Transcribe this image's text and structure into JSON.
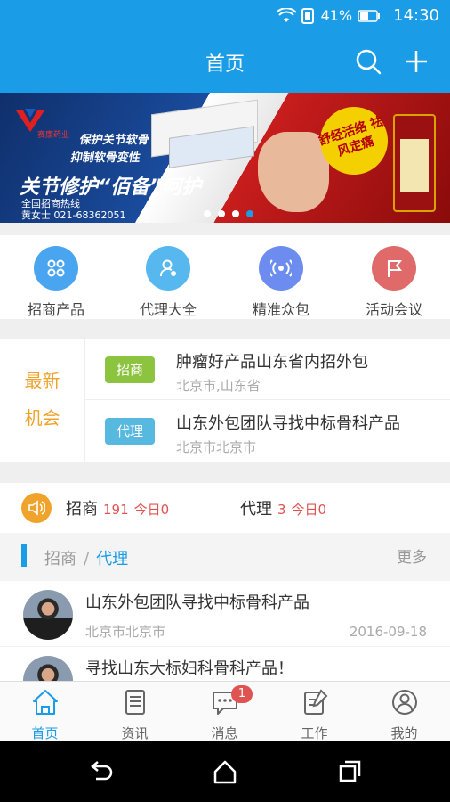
{
  "status_bar": {
    "battery": "41%",
    "time": "14:30"
  },
  "app_bar": {
    "title": "首页"
  },
  "banner": {
    "logo_text": "赛康药业",
    "tag1": "保护关节软骨",
    "tag2": "抑制软骨变性",
    "slogan": "关节修护“佰备”呵护",
    "hotline_line1": "全国招商热线",
    "hotline_line2": "黄女士  021-68362051",
    "promo": "舒经活络 祛风定痛",
    "slides": 4,
    "active_slide": 4
  },
  "quick_menu": [
    {
      "label": "招商产品",
      "icon": "grid-icon",
      "color": "#4aa5f0"
    },
    {
      "label": "代理大全",
      "icon": "user-badge-icon",
      "color": "#57b8f0"
    },
    {
      "label": "精准众包",
      "icon": "broadcast-icon",
      "color": "#6c8cf0"
    },
    {
      "label": "活动会议",
      "icon": "flag-icon",
      "color": "#e06a6a"
    }
  ],
  "latest": {
    "title_line1": "最新",
    "title_line2": "机会",
    "items": [
      {
        "badge": "招商",
        "badge_color": "#8cc43f",
        "title": "肿瘤好产品山东省内招外包",
        "location": "北京市,山东省"
      },
      {
        "badge": "代理",
        "badge_color": "#57b8e0",
        "title": "山东外包团队寻找中标骨科产品",
        "location": "北京市北京市"
      }
    ]
  },
  "stats": {
    "zhaoshang_label": "招商",
    "zhaoshang_count": "191",
    "zhaoshang_today": "今日0",
    "daili_label": "代理",
    "daili_count": "3",
    "daili_today": "今日0"
  },
  "section": {
    "tab_a": "招商",
    "separator": "/",
    "tab_b": "代理",
    "more": "更多"
  },
  "list": [
    {
      "title": "山东外包团队寻找中标骨科产品",
      "location": "北京市北京市",
      "date": "2016-09-18"
    },
    {
      "title": "寻找山东大标妇科骨科产品！",
      "location": "",
      "date": ""
    }
  ],
  "tab_bar": [
    {
      "label": "首页",
      "icon": "home-icon",
      "active": true
    },
    {
      "label": "资讯",
      "icon": "news-icon",
      "active": false
    },
    {
      "label": "消息",
      "icon": "message-icon",
      "active": false,
      "badge": "1"
    },
    {
      "label": "工作",
      "icon": "edit-icon",
      "active": false
    },
    {
      "label": "我的",
      "icon": "profile-icon",
      "active": false
    }
  ],
  "colors": {
    "primary": "#1a9de6",
    "accent": "#f0a32a",
    "alert": "#e05353"
  }
}
